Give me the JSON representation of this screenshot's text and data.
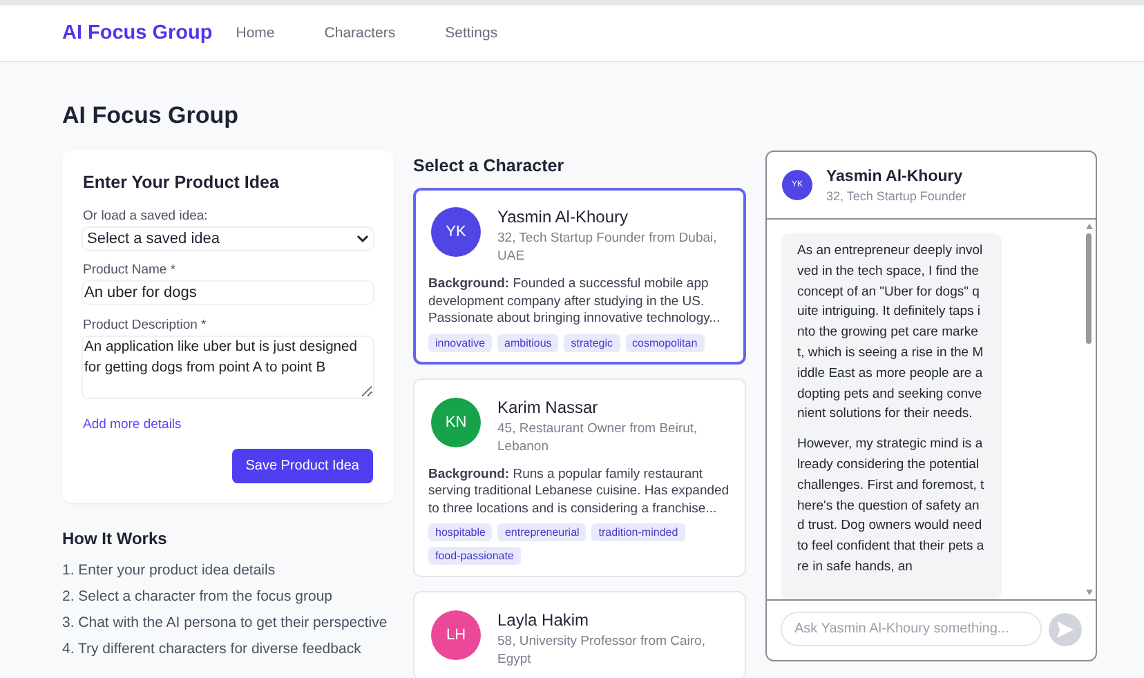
{
  "nav": {
    "brand": "AI Focus Group",
    "links": [
      {
        "label": "Home"
      },
      {
        "label": "Characters"
      },
      {
        "label": "Settings"
      }
    ]
  },
  "page_title": "AI Focus Group",
  "idea_form": {
    "title": "Enter Your Product Idea",
    "saved_label": "Or load a saved idea:",
    "saved_value": "Select a saved idea",
    "name_label": "Product Name *",
    "name_value": "An uber for dogs",
    "desc_label": "Product Description *",
    "desc_value": "An application like uber but is just designed for getting dogs from point A to point B",
    "more_link": "Add more details",
    "save_button": "Save Product Idea"
  },
  "how_it_works": {
    "title": "How It Works",
    "steps": [
      "1. Enter your product idea details",
      "2. Select a character from the focus group",
      "3. Chat with the AI persona to get their perspective",
      "4. Try different characters for diverse feedback"
    ]
  },
  "characters_title": "Select a Character",
  "characters": [
    {
      "initials": "YK",
      "color": "#4f46e5",
      "name": "Yasmin Al-Khoury",
      "subtitle": "32, Tech Startup Founder from Dubai, UAE",
      "background": "**Background:** Founded a successful mobile app development company after studying in the US. Passionate about bringing innovative technology...",
      "tags": [
        "innovative",
        "ambitious",
        "strategic",
        "cosmopolitan"
      ],
      "selected": true
    },
    {
      "initials": "KN",
      "color": "#16a34a",
      "name": "Karim Nassar",
      "subtitle": "45, Restaurant Owner from Beirut, Lebanon",
      "background": "**Background:** Runs a popular family restaurant serving traditional Lebanese cuisine. Has expanded to three locations and is considering a franchise...",
      "tags": [
        "hospitable",
        "entrepreneurial",
        "tradition-minded",
        "food-passionate"
      ],
      "selected": false
    },
    {
      "initials": "LH",
      "color": "#ec4899",
      "name": "Layla Hakim",
      "subtitle": "58, University Professor from Cairo, Egypt",
      "selected": false
    }
  ],
  "chat": {
    "initials": "YK",
    "color": "#4f46e5",
    "name": "Yasmin Al-Khoury",
    "subtitle": "32, Tech Startup Founder",
    "messages": [
      "As an entrepreneur deeply involved in the tech space, I find the concept of an \"Uber for dogs\" quite intriguing. It definitely taps into the growing pet care market, which is seeing a rise in the Middle East as more people are adopting pets and seeking convenient solutions for their needs.",
      "However, my strategic mind is already considering the potential challenges. First and foremost, there's the question of safety and trust. Dog owners would need to feel confident that their pets are in safe hands, an"
    ],
    "input_placeholder": "Ask Yasmin Al-Khoury something..."
  }
}
